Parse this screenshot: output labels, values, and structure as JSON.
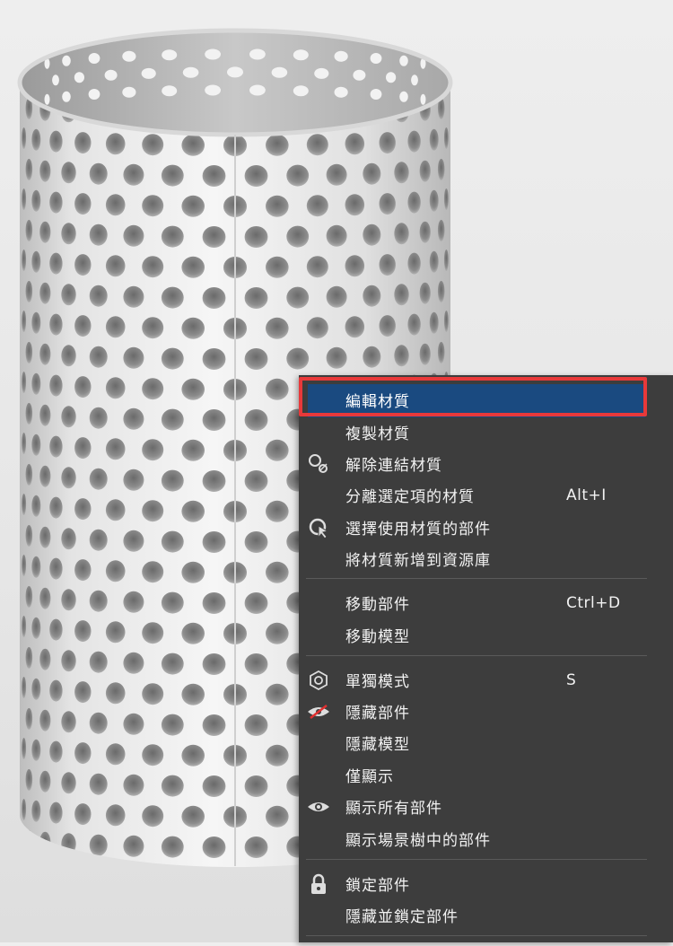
{
  "menu": {
    "items": [
      {
        "label": "編輯材質",
        "shortcut": "",
        "icon": ""
      },
      {
        "label": "複製材質",
        "shortcut": "",
        "icon": ""
      },
      {
        "label": "解除連結材質",
        "shortcut": "",
        "icon": "unlink-icon"
      },
      {
        "label": "分離選定項的材質",
        "shortcut": "Alt+I",
        "icon": ""
      },
      {
        "label": "選擇使用材質的部件",
        "shortcut": "",
        "icon": "select-parts-icon"
      },
      {
        "label": "將材質新增到資源庫",
        "shortcut": "",
        "icon": ""
      },
      {
        "label": "移動部件",
        "shortcut": "Ctrl+D",
        "icon": ""
      },
      {
        "label": "移動模型",
        "shortcut": "",
        "icon": ""
      },
      {
        "label": "單獨模式",
        "shortcut": "S",
        "icon": "solo-mode-icon"
      },
      {
        "label": "隱藏部件",
        "shortcut": "",
        "icon": "hide-icon"
      },
      {
        "label": "隱藏模型",
        "shortcut": "",
        "icon": ""
      },
      {
        "label": "僅顯示",
        "shortcut": "",
        "icon": ""
      },
      {
        "label": "顯示所有部件",
        "shortcut": "",
        "icon": "eye-icon"
      },
      {
        "label": "顯示場景樹中的部件",
        "shortcut": "",
        "icon": ""
      },
      {
        "label": "鎖定部件",
        "shortcut": "",
        "icon": "lock-icon"
      },
      {
        "label": "隱藏並鎖定部件",
        "shortcut": "",
        "icon": ""
      }
    ],
    "highlighted_index": 0
  },
  "colors": {
    "menu_bg": "#3d3d3d",
    "highlight_bg": "#1a4a80",
    "highlight_border": "#e8393a",
    "text": "#f2f2f2"
  }
}
